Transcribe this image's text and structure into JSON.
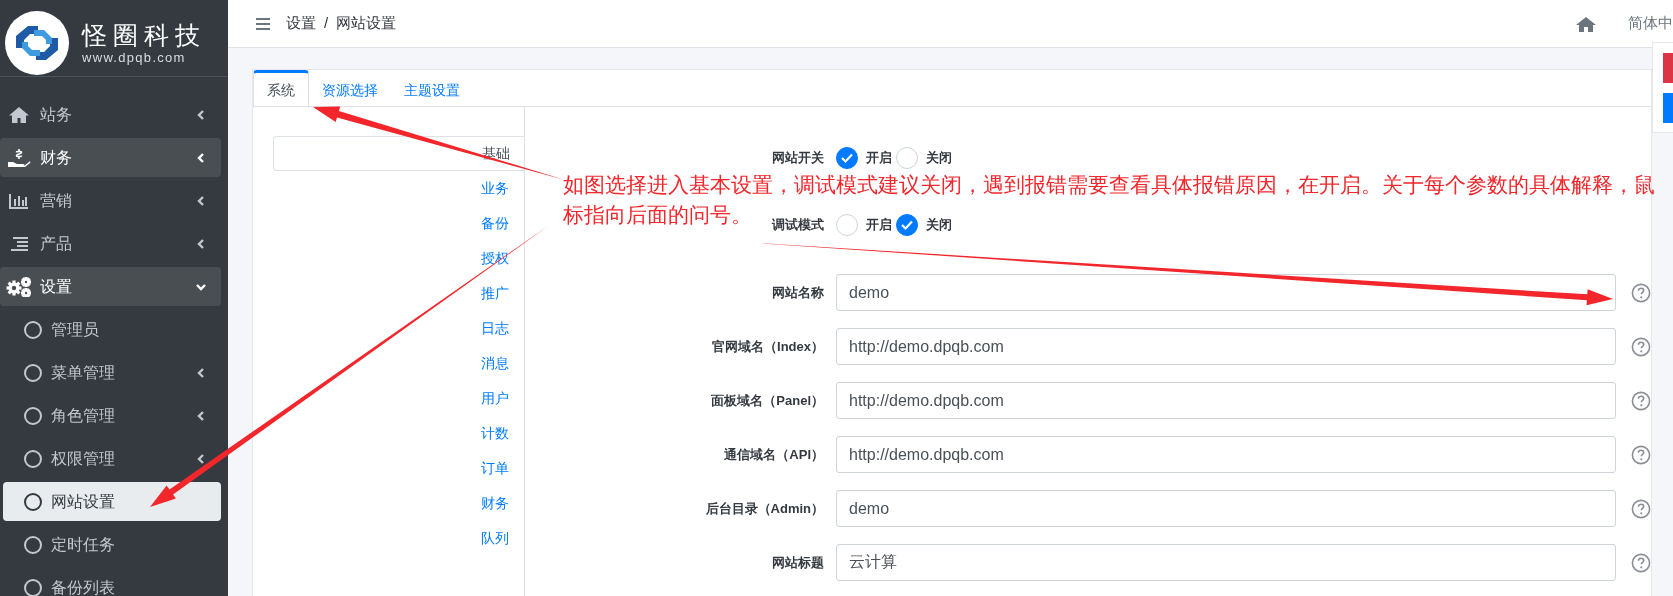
{
  "sidebar": {
    "logo": {
      "name": "怪圈科技",
      "url": "www.dpqb.com"
    },
    "items": [
      {
        "label": "站务",
        "kind": "home",
        "highlighted": false,
        "expanded": false
      },
      {
        "label": "财务",
        "kind": "money",
        "highlighted": true,
        "expanded": false
      },
      {
        "label": "营销",
        "kind": "chart",
        "highlighted": false,
        "expanded": false
      },
      {
        "label": "产品",
        "kind": "list",
        "highlighted": false,
        "expanded": false
      },
      {
        "label": "设置",
        "kind": "gears",
        "highlighted": true,
        "expanded": true,
        "children": [
          {
            "label": "管理员",
            "selected": false,
            "expandable": false
          },
          {
            "label": "菜单管理",
            "selected": false,
            "expandable": true
          },
          {
            "label": "角色管理",
            "selected": false,
            "expandable": true
          },
          {
            "label": "权限管理",
            "selected": false,
            "expandable": true
          },
          {
            "label": "网站设置",
            "selected": true,
            "expandable": false
          },
          {
            "label": "定时任务",
            "selected": false,
            "expandable": false
          },
          {
            "label": "备份列表",
            "selected": false,
            "expandable": false
          }
        ]
      }
    ]
  },
  "header": {
    "breadcrumb": [
      "设置",
      "网站设置"
    ],
    "separator": "/",
    "language": "简体中"
  },
  "tabs": [
    {
      "label": "系统",
      "selected": true
    },
    {
      "label": "资源选择",
      "selected": false
    },
    {
      "label": "主题设置",
      "selected": false
    }
  ],
  "section_nav": [
    {
      "label": "基础",
      "selected": true
    },
    {
      "label": "业务",
      "selected": false
    },
    {
      "label": "备份",
      "selected": false
    },
    {
      "label": "授权",
      "selected": false
    },
    {
      "label": "推广",
      "selected": false
    },
    {
      "label": "日志",
      "selected": false
    },
    {
      "label": "消息",
      "selected": false
    },
    {
      "label": "用户",
      "selected": false
    },
    {
      "label": "计数",
      "selected": false
    },
    {
      "label": "订单",
      "selected": false
    },
    {
      "label": "财务",
      "selected": false
    },
    {
      "label": "队列",
      "selected": false
    }
  ],
  "form": [
    {
      "kind": "radio",
      "label": "网站开关",
      "options": [
        {
          "label": "开启",
          "selected": true
        },
        {
          "label": "关闭",
          "selected": false
        }
      ]
    },
    {
      "kind": "radio",
      "label": "调试模式",
      "options": [
        {
          "label": "开启",
          "selected": false
        },
        {
          "label": "关闭",
          "selected": true
        }
      ]
    },
    {
      "kind": "text",
      "label": "网站名称",
      "value": "demo"
    },
    {
      "kind": "text",
      "label": "官网域名（Index）",
      "value": "http://demo.dpqb.com"
    },
    {
      "kind": "text",
      "label": "面板域名（Panel）",
      "value": "http://demo.dpqb.com"
    },
    {
      "kind": "text",
      "label": "通信域名（API）",
      "value": "http://demo.dpqb.com"
    },
    {
      "kind": "text",
      "label": "后台目录（Admin）",
      "value": "demo"
    },
    {
      "kind": "text",
      "label": "网站标题",
      "value": "云计算"
    }
  ],
  "annotation": {
    "lines": [
      "如图选择进入基本设置，调试模式建议关闭，遇到报错需要查看具体报错原因，在开启。关于每个参数的具体解释，鼠",
      "标指向后面的问号。"
    ]
  }
}
